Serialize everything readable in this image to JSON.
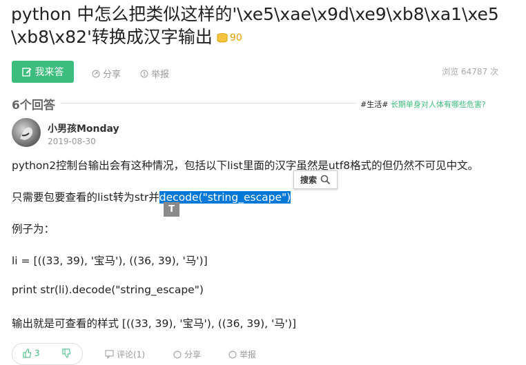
{
  "question": {
    "title": "python 中怎么把类似这样的'\\xe5\\xae\\x9d\\xe9\\xb8\\xa1\\xe5\\xb8\\x82'转换成汉字输出",
    "reward": "90"
  },
  "toolbar": {
    "answer_label": "我来答",
    "share_label": "分享",
    "report_label": "举报",
    "views": "浏览 64787 次"
  },
  "answers_header": {
    "count_label": "6个回答",
    "hot_tag": "#生活#",
    "hot_link": "长期单身对人体有哪些危害?"
  },
  "answer": {
    "author": "小男孩Monday",
    "date": "2019-08-30",
    "p1": "python2控制台输出会有这种情况，包括以下list里面的汉字虽然是utf8格式的但仍然不可见中文。",
    "p2_prefix": "只需要包要查看的list转为str并",
    "p2_selected": "decode(\"string_escape\")",
    "p3": "例子为：",
    "p4": "li = [((33, 39), '宝马'), ((36, 39), '马')]",
    "p5": "print str(li).decode(\"string_escape\")",
    "p6": "输出就是可查看的样式 [((33, 39), '宝马'), ((36, 39), '马')]"
  },
  "selection_popup": {
    "search_label": "搜索",
    "translate_label": "T"
  },
  "answer_footer": {
    "like_count": "3",
    "comment_label": "评论(1)",
    "share_label": "分享",
    "report_label": "举报"
  },
  "colors": {
    "accent": "#3dbd7d",
    "selection": "#0078d7",
    "coin": "#e5a100"
  }
}
